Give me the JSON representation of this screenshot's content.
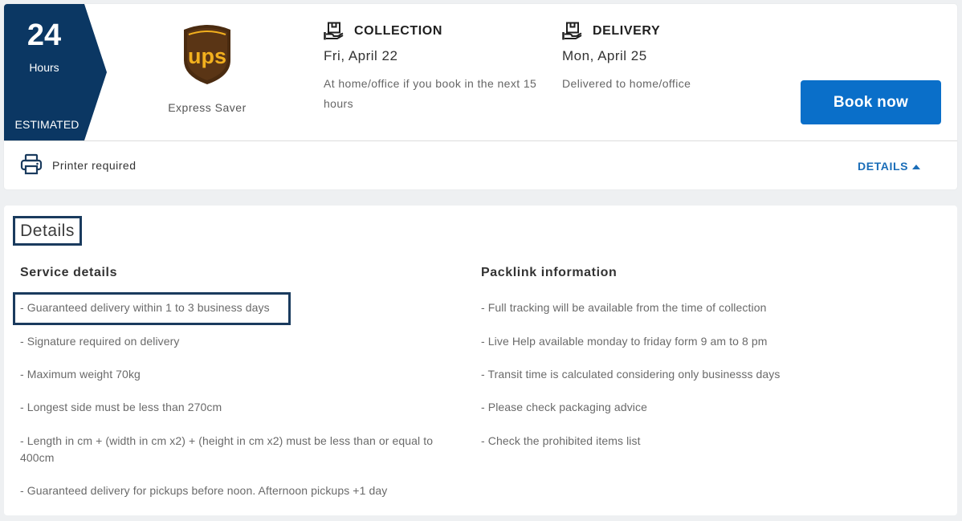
{
  "offer": {
    "badge": {
      "number": "24",
      "unit": "Hours",
      "label": "ESTIMATED",
      "color": "#0b3763"
    },
    "carrier": {
      "logo_text": "ups",
      "service": "Express Saver"
    },
    "collection": {
      "icon": "box-hand-icon",
      "title": "COLLECTION",
      "date": "Fri, April 22",
      "note": "At home/office if you book in the next 15 hours"
    },
    "delivery": {
      "icon": "box-hand-icon",
      "title": "DELIVERY",
      "date": "Mon, April 25",
      "note": "Delivered to home/office"
    },
    "book_label": "Book now",
    "printer_label": "Printer required",
    "details_label": "DETAILS",
    "accent": "#0a6fc9"
  },
  "details": {
    "title": "Details",
    "service": {
      "heading": "Service details",
      "items": [
        "- Guaranteed delivery within 1 to 3 business days",
        "- Signature required on delivery",
        "- Maximum weight 70kg",
        "- Longest side must be less than 270cm",
        "- Length in cm + (width in cm x2) + (height in cm x2) must be less than or equal to 400cm",
        "- Guaranteed delivery for pickups before noon. Afternoon pickups +1 day"
      ]
    },
    "packlink": {
      "heading": "Packlink information",
      "items": [
        "- Full tracking will be available from the time of collection",
        "- Live Help available monday to friday form 9 am to 8 pm",
        "- Transit time is calculated considering only businesss days",
        "- Please check packaging advice",
        "- Check the prohibited items list"
      ]
    }
  }
}
